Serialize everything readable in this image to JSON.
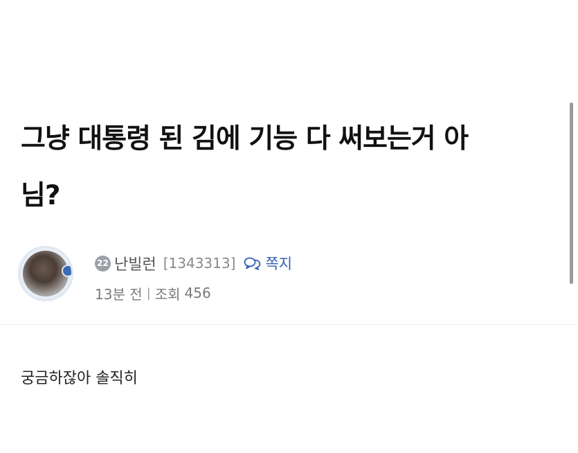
{
  "post": {
    "title": "그냥 대통령 된 김에 기능 다 써보는거 아님?",
    "body": "궁금하잖아 솔직히"
  },
  "author": {
    "level": "22",
    "nickname": "난빌런",
    "user_id": "[1343313]",
    "message_label": "쪽지"
  },
  "meta": {
    "time": "13분 전",
    "separator": "|",
    "views_label": "조회",
    "views_count": "456"
  },
  "icons": {
    "message": "chat-bubbles-icon",
    "avatar": "user-avatar"
  },
  "colors": {
    "link": "#2f5fb5",
    "level_badge": "#9aa0a6"
  }
}
